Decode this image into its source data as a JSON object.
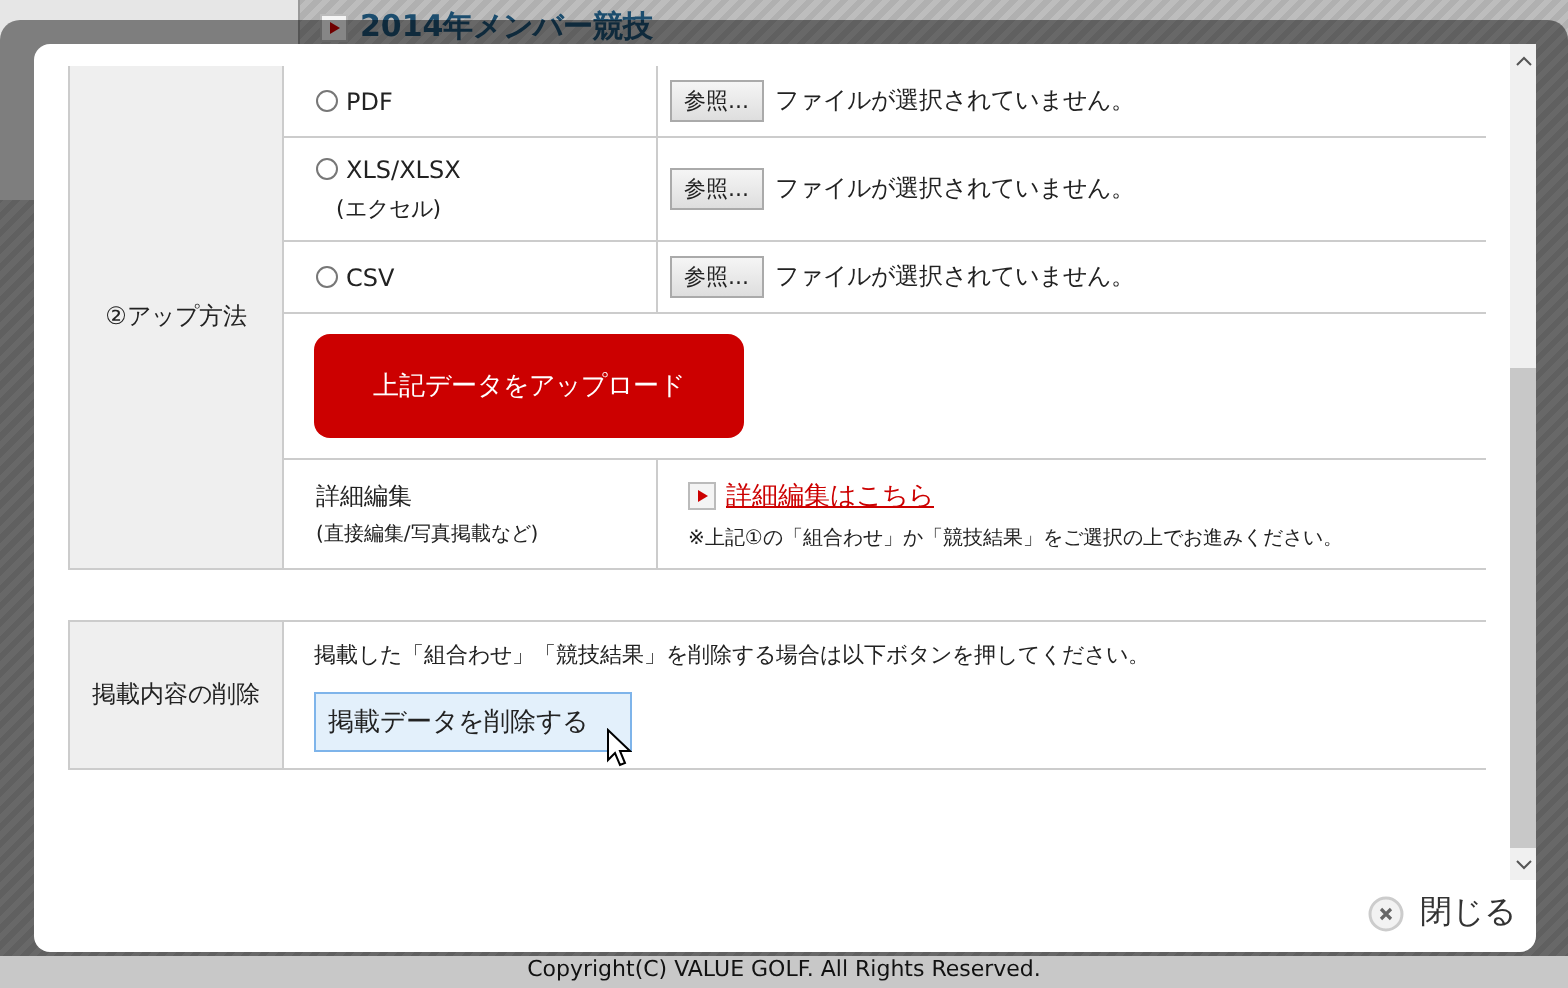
{
  "background_page": {
    "heading": "2014年メンバー競技",
    "footer": "Copyright(C) VALUE GOLF. All Rights Reserved."
  },
  "dialog": {
    "upload_section": {
      "label": "②アップ方法",
      "formats": [
        {
          "label": "PDF",
          "selected": false,
          "browse": "参照...",
          "file_status": "ファイルが選択されていません。"
        },
        {
          "label": "XLS/XLSX",
          "note": "(エクセル)",
          "selected": false,
          "browse": "参照...",
          "file_status": "ファイルが選択されていません。"
        },
        {
          "label": "CSV",
          "selected": false,
          "browse": "参照...",
          "file_status": "ファイルが選択されていません。"
        }
      ],
      "upload_button": "上記データをアップロード",
      "detail": {
        "label": "詳細編集",
        "sublabel": "(直接編集/写真掲載など)",
        "link": "詳細編集はこちら",
        "note": "※上記①の「組合わせ」か「競技結果」をご選択の上でお進みください。"
      }
    },
    "delete_section": {
      "label": "掲載内容の削除",
      "description": "掲載した「組合わせ」「競技結果」を削除する場合は以下ボタンを押してください。",
      "button": "掲載データを削除する"
    },
    "close_button": "閉じる"
  }
}
